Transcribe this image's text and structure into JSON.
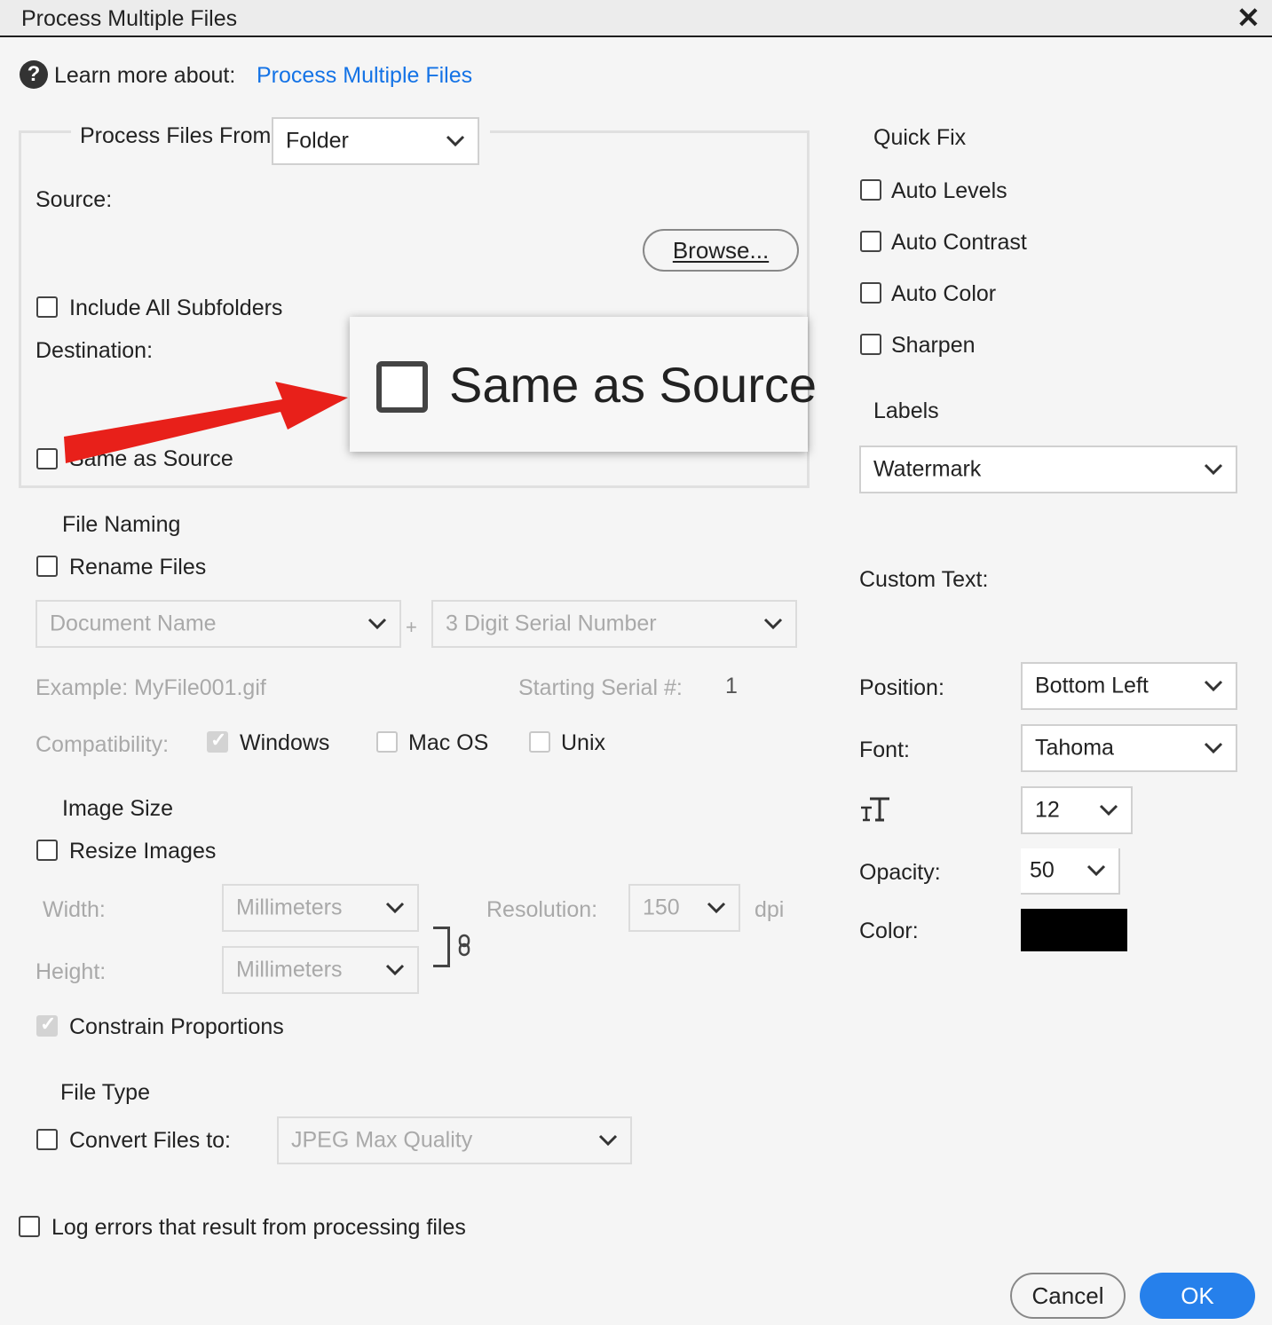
{
  "window": {
    "title": "Process Multiple Files"
  },
  "help": {
    "learn_more_label": "Learn more about:",
    "link_text": "Process Multiple Files"
  },
  "source_group": {
    "process_from_label": "Process Files From:",
    "process_from_value": "Folder",
    "source_label": "Source:",
    "browse_label": "Browse...",
    "include_subfolders_label": "Include All Subfolders",
    "destination_label": "Destination:",
    "same_as_source_label": "Same as Source"
  },
  "callout": {
    "label": "Same as Source",
    "arrow_color": "#e8201a"
  },
  "file_naming": {
    "heading": "File Naming",
    "rename_label": "Rename Files",
    "name_part1": "Document Name",
    "plus": "+",
    "name_part2": "3 Digit Serial Number",
    "example": "Example: MyFile001.gif",
    "starting_serial_label": "Starting Serial #:",
    "starting_serial_value": "1",
    "compatibility_label": "Compatibility:",
    "windows_label": "Windows",
    "macos_label": "Mac OS",
    "unix_label": "Unix"
  },
  "image_size": {
    "heading": "Image Size",
    "resize_label": "Resize Images",
    "width_label": "Width:",
    "width_unit": "Millimeters",
    "height_label": "Height:",
    "height_unit": "Millimeters",
    "resolution_label": "Resolution:",
    "resolution_value": "150",
    "dpi_label": "dpi",
    "constrain_label": "Constrain Proportions"
  },
  "file_type": {
    "heading": "File Type",
    "convert_label": "Convert Files to:",
    "convert_value": "JPEG Max Quality"
  },
  "log_errors_label": "Log errors that result from processing files",
  "quick_fix": {
    "heading": "Quick Fix",
    "items": [
      "Auto Levels",
      "Auto Contrast",
      "Auto Color",
      "Sharpen"
    ]
  },
  "labels": {
    "heading": "Labels",
    "value": "Watermark",
    "custom_text_label": "Custom Text:",
    "position_label": "Position:",
    "position_value": "Bottom Left",
    "font_label": "Font:",
    "font_value": "Tahoma",
    "size_value": "12",
    "opacity_label": "Opacity:",
    "opacity_value": "50",
    "color_label": "Color:",
    "color_value": "#000000"
  },
  "buttons": {
    "cancel": "Cancel",
    "ok": "OK"
  },
  "colors": {
    "accent": "#2680eb",
    "link": "#1473e6"
  }
}
